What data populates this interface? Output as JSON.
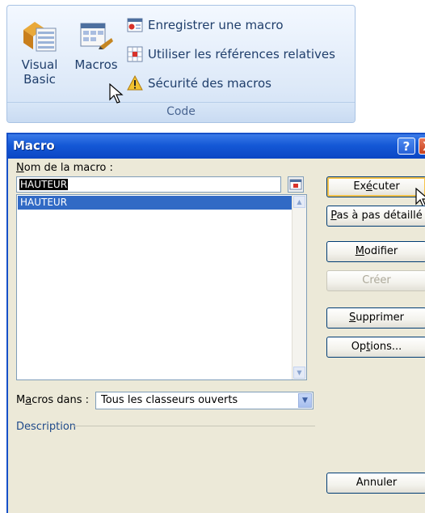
{
  "ribbon": {
    "visual_basic_label": "Visual Basic",
    "macros_label": "Macros",
    "record_macro": "Enregistrer une macro",
    "relative_refs": "Utiliser les références relatives",
    "macro_security": "Sécurité des macros",
    "group_label": "Code"
  },
  "dialog": {
    "title": "Macro",
    "help_glyph": "?",
    "close_glyph": "X",
    "name_label_first": "N",
    "name_label_rest": "om de la macro :",
    "name_value": "HAUTEUR",
    "macros": [
      "HAUTEUR"
    ],
    "macros_in_label_first": "M",
    "macros_in_label_mid": "a",
    "macros_in_label_rest": "cros dans :",
    "macros_in_value": "Tous les classeurs ouverts",
    "description_label": "Description",
    "buttons": {
      "execute_a": "Ex",
      "execute_u": "é",
      "execute_b": "cuter",
      "step_u": "P",
      "step_rest": "as à pas détaillé",
      "modify_u": "M",
      "modify_rest": "odifier",
      "create": "Créer",
      "delete_u": "S",
      "delete_rest": "upprimer",
      "options_a": "Op",
      "options_u": "t",
      "options_b": "ions...",
      "cancel": "Annuler"
    }
  },
  "colors": {
    "titlebar": "#1458d6",
    "dialog_bg": "#ece9d8",
    "selection": "#316ac5",
    "ribbon_text": "#1f3e6b"
  },
  "icons": [
    "visual-basic-icon",
    "macros-icon",
    "record-macro-icon",
    "relative-references-icon",
    "warning-icon",
    "cursor-icon",
    "reference-picker-icon"
  ]
}
